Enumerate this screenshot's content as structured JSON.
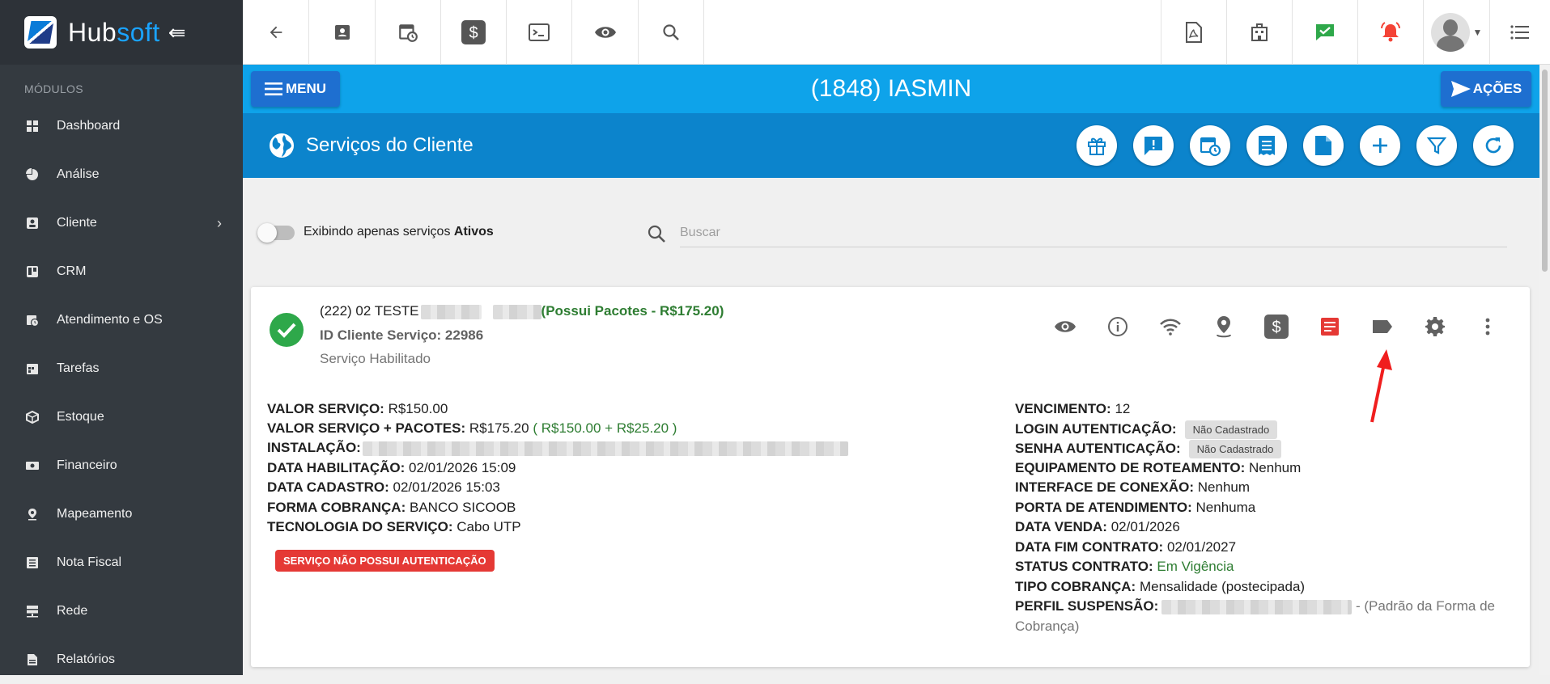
{
  "brand": {
    "name_part1": "Hub",
    "name_part2": "soft"
  },
  "sidebar": {
    "section_label": "MÓDULOS",
    "items": [
      {
        "label": "Dashboard",
        "icon": "dashboard-icon"
      },
      {
        "label": "Análise",
        "icon": "pie-chart-icon"
      },
      {
        "label": "Cliente",
        "icon": "contact-card-icon"
      },
      {
        "label": "CRM",
        "icon": "trello-board-icon"
      },
      {
        "label": "Atendimento e OS",
        "icon": "calendar-clock-icon"
      },
      {
        "label": "Tarefas",
        "icon": "tasks-calendar-icon"
      },
      {
        "label": "Estoque",
        "icon": "box-icon"
      },
      {
        "label": "Financeiro",
        "icon": "money-icon"
      },
      {
        "label": "Mapeamento",
        "icon": "map-marker-icon"
      },
      {
        "label": "Nota Fiscal",
        "icon": "document-list-icon"
      },
      {
        "label": "Rede",
        "icon": "server-icon"
      },
      {
        "label": "Relatórios",
        "icon": "report-icon"
      }
    ]
  },
  "header": {
    "menu_label": "MENU",
    "client_title": "(1848) IASMIN",
    "acoes_label": "AÇÕES"
  },
  "section": {
    "title": "Serviços do Cliente"
  },
  "filter": {
    "toggle_text": "Exibindo apenas serviços ",
    "toggle_bold": "Ativos",
    "search_placeholder": "Buscar"
  },
  "service": {
    "title_prefix": "(222) 02 TESTE",
    "package_text": "(Possui Pacotes - R$175.20)",
    "id_text": "ID Cliente Serviço: 22986",
    "status_text": "Serviço Habilitado",
    "no_auth_badge": "SERVIÇO NÃO POSSUI AUTENTICAÇÃO",
    "left_fields": [
      {
        "label": "VALOR SERVIÇO:",
        "value": "R$150.00"
      },
      {
        "label": "VALOR SERVIÇO + PACOTES:",
        "value": "R$175.20",
        "extra": "( R$150.00 + R$25.20 )"
      },
      {
        "label": "INSTALAÇÃO:",
        "value": ""
      },
      {
        "label": "DATA HABILITAÇÃO:",
        "value": "02/01/2026 15:09"
      },
      {
        "label": "DATA CADASTRO:",
        "value": "02/01/2026 15:03"
      },
      {
        "label": "FORMA COBRANÇA:",
        "value": "BANCO SICOOB"
      },
      {
        "label": "TECNOLOGIA DO SERVIÇO:",
        "value": "Cabo UTP"
      }
    ],
    "right_fields": [
      {
        "label": "VENCIMENTO:",
        "value": "12"
      },
      {
        "label": "LOGIN AUTENTICAÇÃO:",
        "chip": "Não Cadastrado"
      },
      {
        "label": "SENHA AUTENTICAÇÃO:",
        "chip": "Não Cadastrado"
      },
      {
        "label": "EQUIPAMENTO DE ROTEAMENTO:",
        "value": "Nenhum"
      },
      {
        "label": "INTERFACE DE CONEXÃO:",
        "value": "Nenhum"
      },
      {
        "label": "PORTA DE ATENDIMENTO:",
        "value": "Nenhuma"
      },
      {
        "label": "DATA VENDA:",
        "value": "02/01/2026"
      },
      {
        "label": "DATA FIM CONTRATO:",
        "value": "02/01/2027"
      },
      {
        "label": "STATUS CONTRATO:",
        "value": "Em Vigência"
      },
      {
        "label": "TIPO COBRANÇA:",
        "value": "Mensalidade (postecipada)"
      },
      {
        "label": "PERFIL SUSPENSÃO:",
        "value": "- (Padrão da Forma de",
        "value2": "Cobrança)"
      }
    ]
  },
  "colors": {
    "sidebar_bg": "#343a40",
    "titlebar_blue": "#0ea3ea",
    "section_blue": "#0c84cc",
    "button_blue": "#1e6fd0",
    "success_green": "#2ea84a",
    "danger_red": "#e53935"
  }
}
